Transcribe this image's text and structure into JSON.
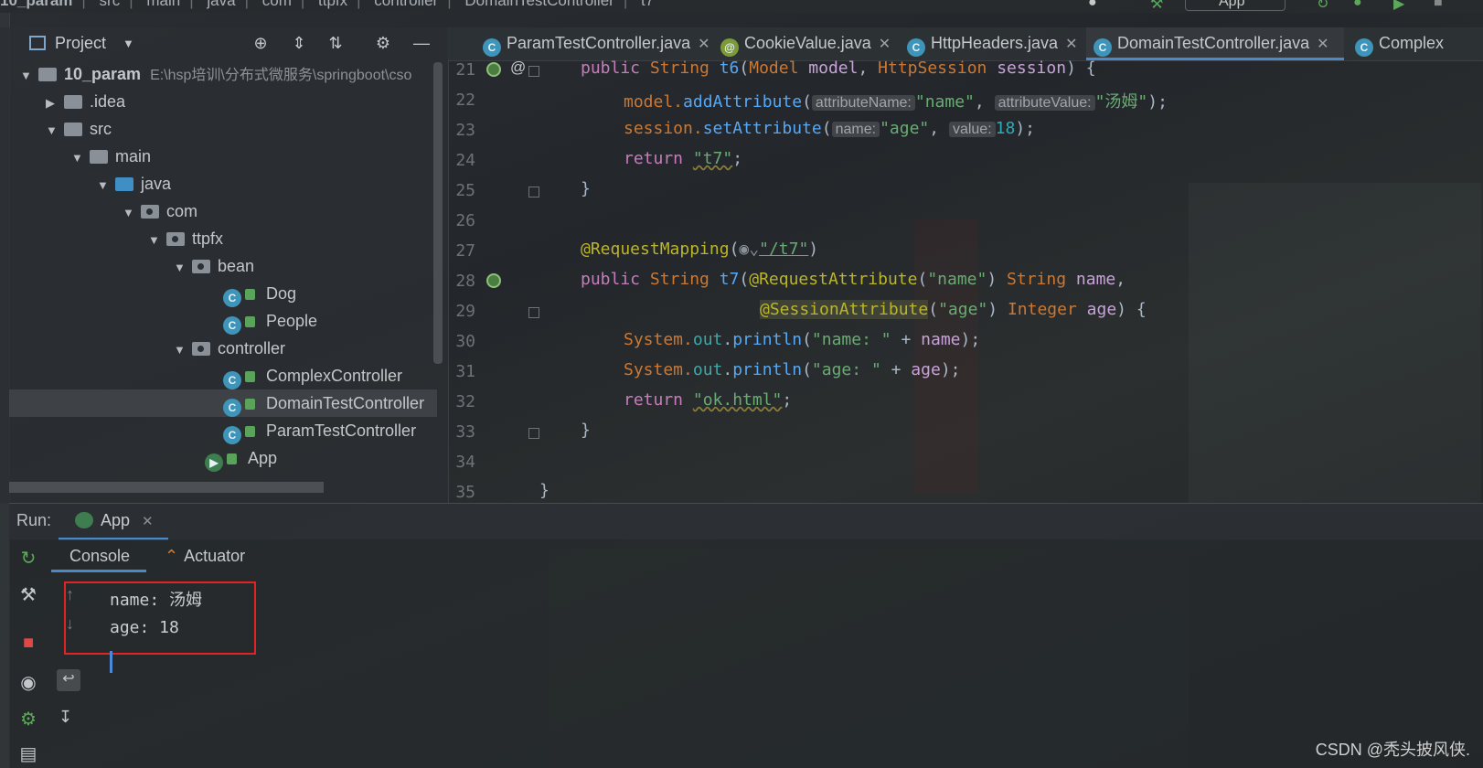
{
  "colors": {
    "accent": "#4a88c7",
    "highlight": "#e02424"
  },
  "breadcrumb": [
    "10_param",
    "src",
    "main",
    "java",
    "com",
    "ttpfx",
    "controller",
    "DomainTestController",
    "t7"
  ],
  "run_config": "App",
  "project_panel": {
    "title": "Project",
    "tree": [
      {
        "label": "10_param",
        "path": "E:\\hsp培训\\分布式微服务\\springboot\\cso",
        "type": "module",
        "level": 0,
        "expanded": true
      },
      {
        "label": ".idea",
        "type": "folder",
        "level": 1,
        "expanded": false
      },
      {
        "label": "src",
        "type": "folder",
        "level": 1,
        "expanded": true
      },
      {
        "label": "main",
        "type": "folder",
        "level": 2,
        "expanded": true
      },
      {
        "label": "java",
        "type": "source-folder",
        "level": 3,
        "expanded": true
      },
      {
        "label": "com",
        "type": "package",
        "level": 4,
        "expanded": true
      },
      {
        "label": "ttpfx",
        "type": "package",
        "level": 5,
        "expanded": true
      },
      {
        "label": "bean",
        "type": "package",
        "level": 6,
        "expanded": true
      },
      {
        "label": "Dog",
        "type": "class",
        "level": 7
      },
      {
        "label": "People",
        "type": "class",
        "level": 7
      },
      {
        "label": "controller",
        "type": "package",
        "level": 6,
        "expanded": true
      },
      {
        "label": "ComplexController",
        "type": "class",
        "level": 7
      },
      {
        "label": "DomainTestController",
        "type": "class",
        "level": 7,
        "selected": true
      },
      {
        "label": "ParamTestController",
        "type": "class",
        "level": 7
      },
      {
        "label": "App",
        "type": "app",
        "level": 6
      }
    ]
  },
  "editor_tabs": [
    {
      "label": "ParamTestController.java",
      "icon": "class-icon"
    },
    {
      "label": "CookieValue.java",
      "icon": "annotation-icon"
    },
    {
      "label": "HttpHeaders.java",
      "icon": "class-icon"
    },
    {
      "label": "DomainTestController.java",
      "icon": "class-icon",
      "active": true
    },
    {
      "label": "Complex",
      "icon": "class-icon"
    }
  ],
  "line_numbers": [
    "21",
    "22",
    "23",
    "24",
    "25",
    "26",
    "27",
    "28",
    "29",
    "30",
    "31",
    "32",
    "33",
    "34",
    "35"
  ],
  "code": {
    "l21": {
      "a": "public ",
      "b": "String ",
      "c": "t6",
      "d": "(",
      "e": "Model ",
      "f": "model",
      "g": ", ",
      "h": "HttpSession ",
      "i": "session",
      "j": ") {"
    },
    "l22": {
      "a": "model.",
      "b": "addAttribute",
      "c": "(",
      "h1": "attributeName:",
      "s1": "\"name\"",
      "c2": ", ",
      "h2": "attributeValue:",
      "s2": "\"汤姆\"",
      "e": ");"
    },
    "l23": {
      "a": "session.",
      "b": "setAttribute",
      "c": "(",
      "h1": "name:",
      "s1": "\"age\"",
      "c2": ", ",
      "h2": "value:",
      "n": "18",
      "e": ");"
    },
    "l24": {
      "a": "return ",
      "s": "\"t7\"",
      "e": ";"
    },
    "l25": "}",
    "l27": {
      "a": "@RequestMapping",
      "b": "(",
      "s": "\"/t7\"",
      "e": ")"
    },
    "l28": {
      "a": "public ",
      "b": "String ",
      "c": "t7",
      "d": "(",
      "an": "@RequestAttribute",
      "p": "(",
      "s": "\"name\"",
      "q": ") ",
      "t": "String ",
      "v": "name",
      "e": ","
    },
    "l29": {
      "an": "@SessionAttribute",
      "p": "(",
      "s": "\"age\"",
      "q": ") ",
      "t": "Integer ",
      "v": "age",
      "e": ") {"
    },
    "l30": {
      "a": "System.",
      "f": "out",
      "d": ".",
      "b": "println",
      "p": "(",
      "s": "\"name: \"",
      "o": " + ",
      "v": "name",
      "e": ");"
    },
    "l31": {
      "a": "System.",
      "f": "out",
      "d": ".",
      "b": "println",
      "p": "(",
      "s": "\"age: \"",
      "o": " + ",
      "v": "age",
      "e": ");"
    },
    "l32": {
      "a": "return ",
      "s": "\"ok.html\"",
      "e": ";"
    },
    "l33": "}",
    "l35": "}"
  },
  "run": {
    "label": "Run:",
    "tab": "App",
    "subtabs": [
      "Console",
      "Actuator"
    ],
    "output": [
      "name: 汤姆",
      "age: 18"
    ]
  },
  "watermark": "CSDN @秃头披风侠."
}
